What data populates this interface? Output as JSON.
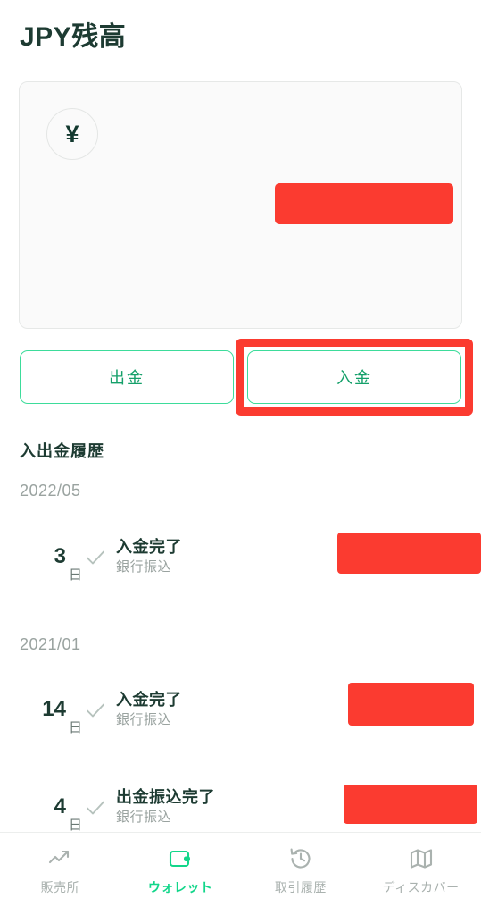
{
  "page": {
    "title": "JPY残高"
  },
  "balance_card": {
    "currency_symbol": "¥",
    "currency_icon": "yen-circle-icon",
    "amount_redacted": true
  },
  "actions": {
    "withdraw_label": "出金",
    "deposit_label": "入金",
    "highlighted": "入金"
  },
  "history": {
    "heading": "入出金履歴",
    "groups": [
      {
        "month": "2022/05",
        "entries": [
          {
            "day": "3",
            "day_unit": "日",
            "status_icon": "check-icon",
            "title": "入金完了",
            "subtitle": "銀行振込",
            "amount_redacted": true
          }
        ]
      },
      {
        "month": "2021/01",
        "entries": [
          {
            "day": "14",
            "day_unit": "日",
            "status_icon": "check-icon",
            "title": "入金完了",
            "subtitle": "銀行振込",
            "amount_redacted": true
          },
          {
            "day": "4",
            "day_unit": "日",
            "status_icon": "check-icon",
            "title": "出金振込完了",
            "subtitle": "銀行振込",
            "amount_redacted": true
          }
        ]
      }
    ]
  },
  "bottom_nav": {
    "items": [
      {
        "label": "販売所",
        "icon": "trending-up-icon",
        "active": false
      },
      {
        "label": "ウォレット",
        "icon": "wallet-icon",
        "active": true
      },
      {
        "label": "取引履歴",
        "icon": "history-clock-icon",
        "active": false
      },
      {
        "label": "ディスカバー",
        "icon": "map-icon",
        "active": false
      }
    ]
  },
  "colors": {
    "title_green": "#1d3b32",
    "accent_green": "#12d68a",
    "button_border": "#3ddc9b",
    "button_text": "#15a06a",
    "redaction_red": "#fb3b30",
    "muted_gray": "#9aa3a0",
    "card_bg": "#fafafa"
  }
}
